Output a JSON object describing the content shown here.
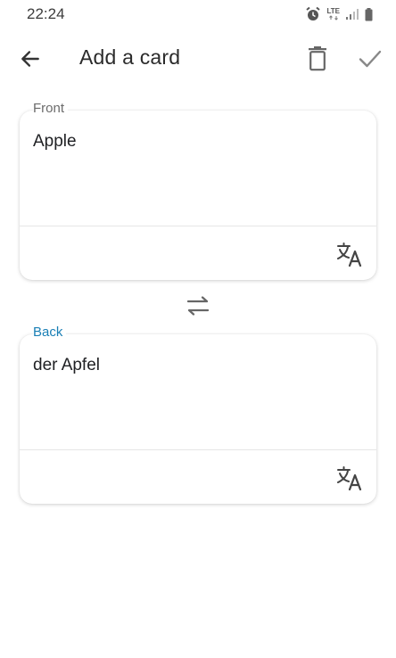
{
  "status_bar": {
    "time": "22:24",
    "network_label": "LTE",
    "icons": [
      "alarm-icon",
      "lte-icon",
      "signal-icon",
      "battery-icon"
    ]
  },
  "app_bar": {
    "title": "Add a card",
    "icons": [
      "back-arrow-icon",
      "trash-icon",
      "checkmark-icon"
    ]
  },
  "front": {
    "label": "Front",
    "value": "Apple",
    "icon": "translate-icon"
  },
  "back": {
    "label": "Back",
    "value": "der Apfel",
    "icon": "translate-icon"
  },
  "swap": {
    "icon": "swap-arrows-icon"
  },
  "colors": {
    "accent": "#1a7fb5",
    "icon": "#4a4a4a",
    "background": "#ffffff"
  }
}
